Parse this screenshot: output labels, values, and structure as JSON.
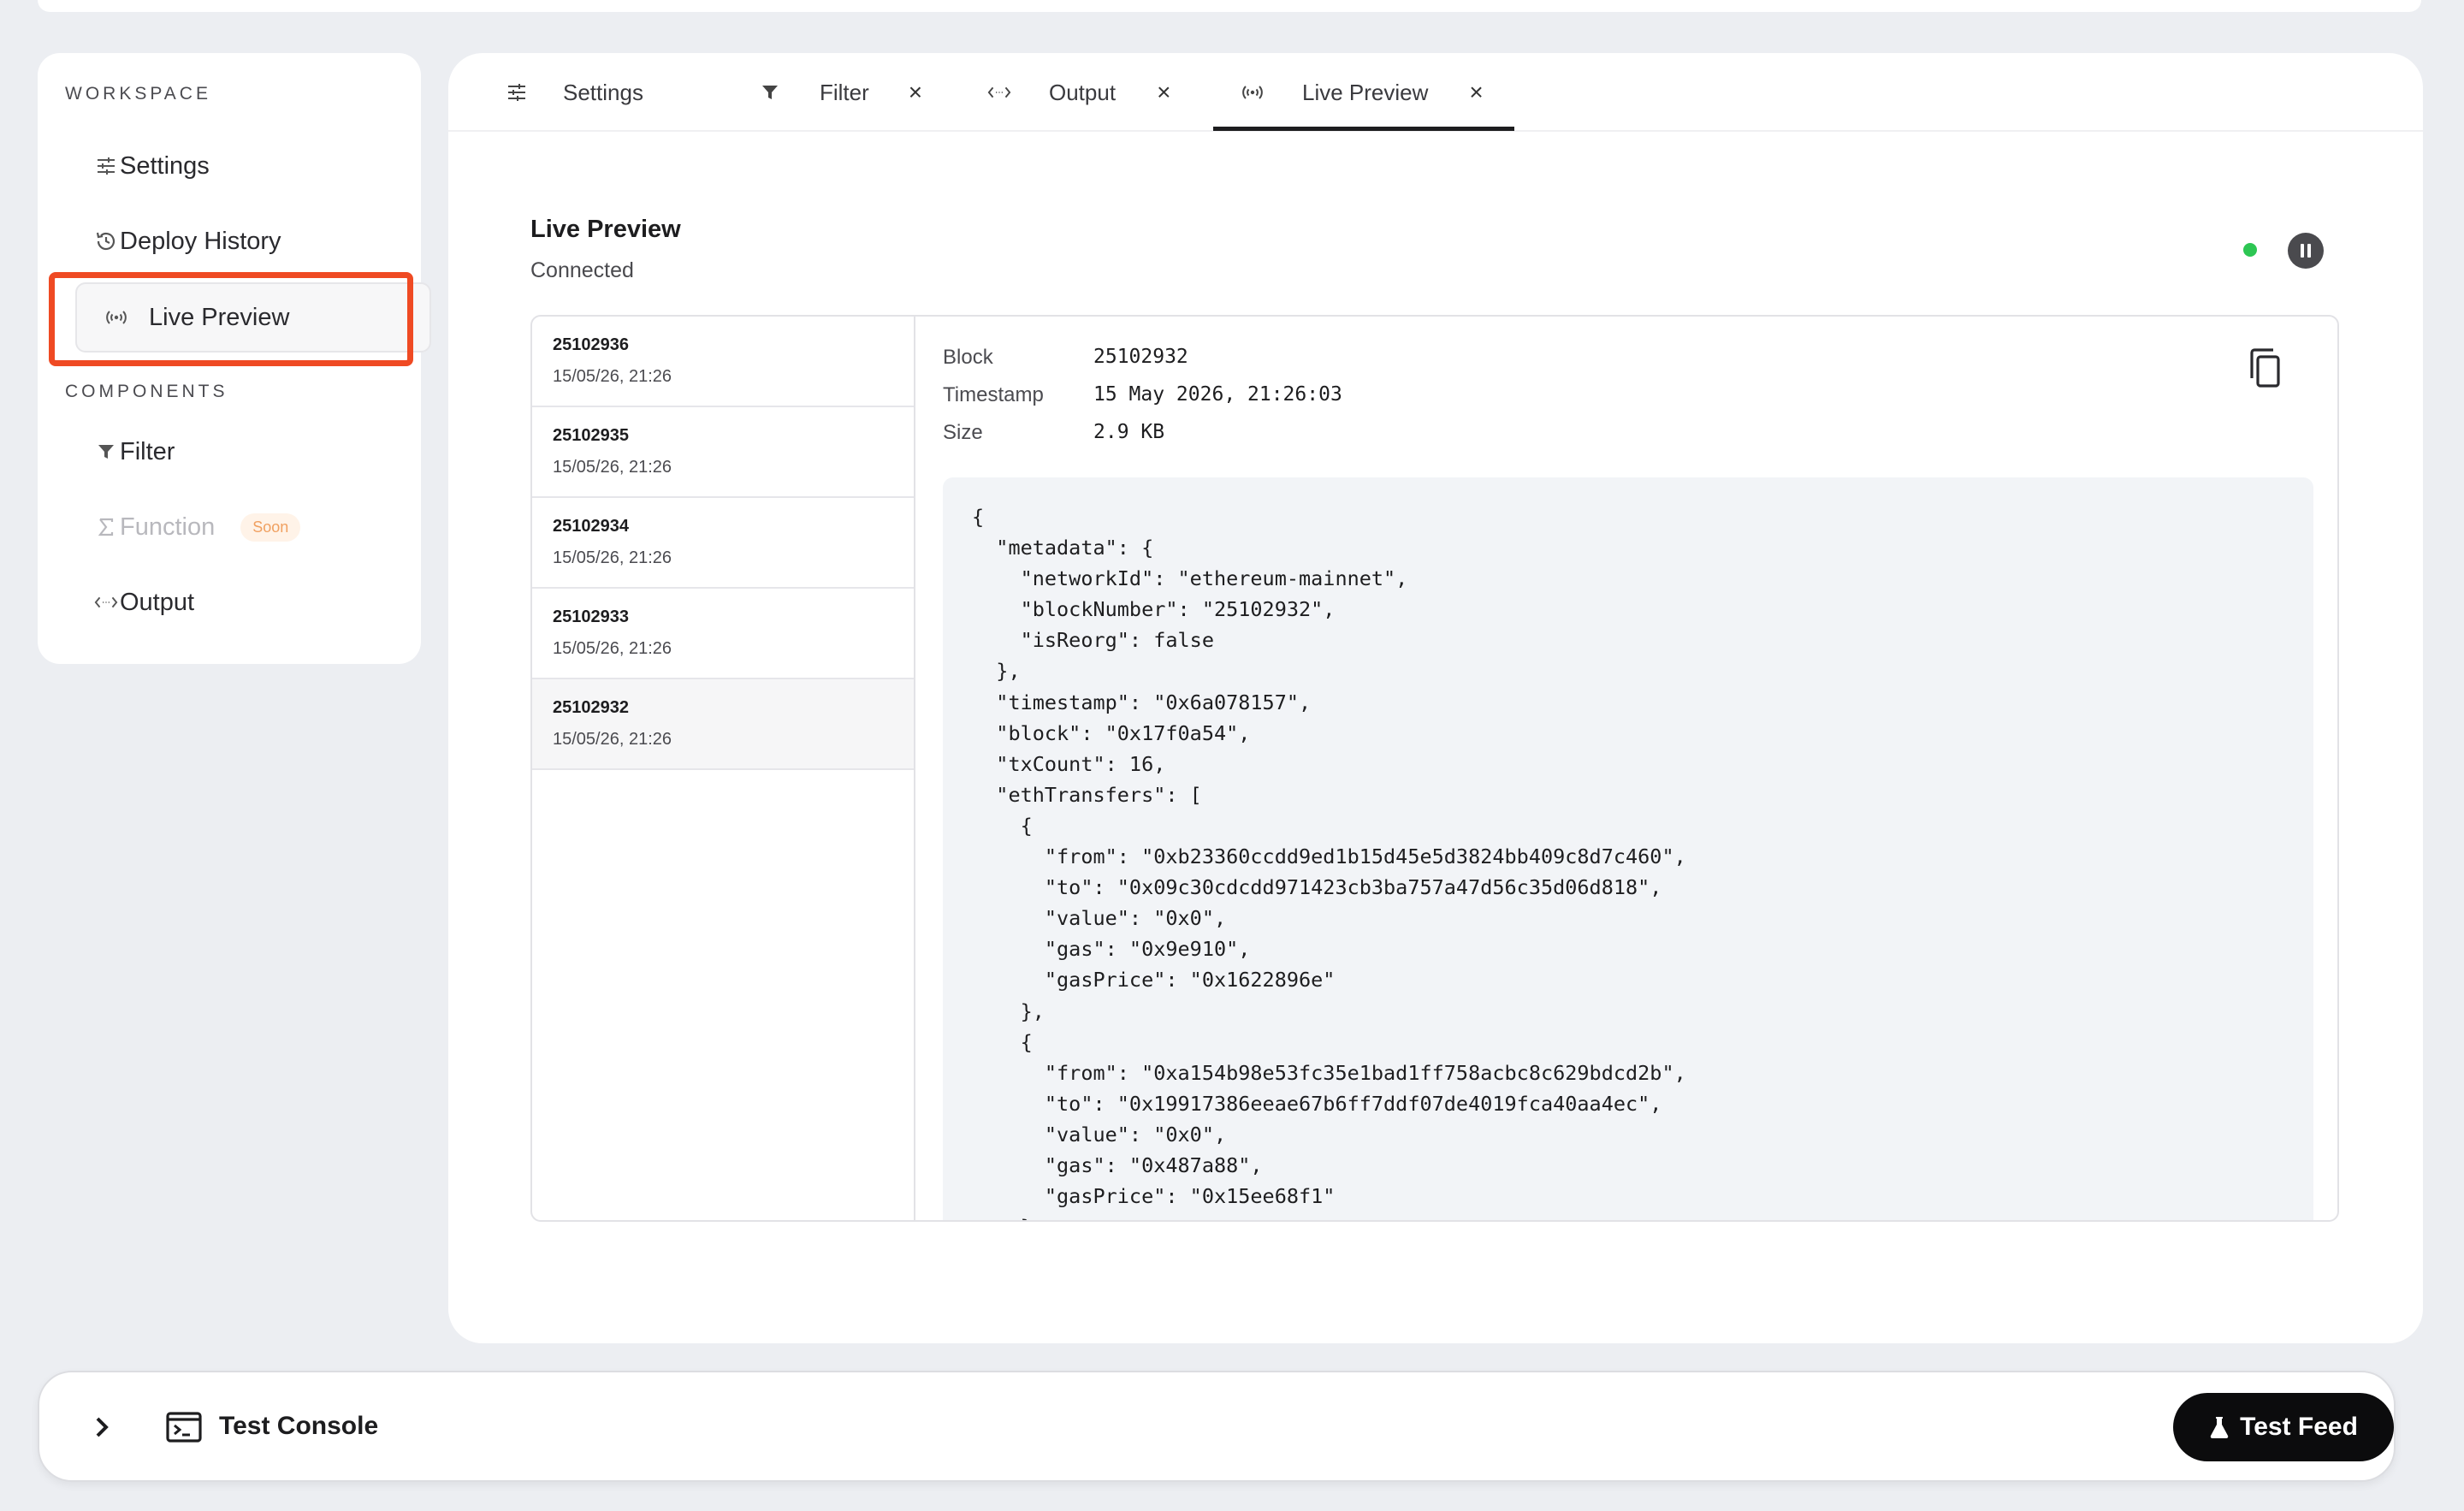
{
  "sidebar": {
    "workspace_title": "WORKSPACE",
    "components_title": "COMPONENTS",
    "items": [
      {
        "label": "Settings",
        "icon": "sliders-icon"
      },
      {
        "label": "Deploy History",
        "icon": "history-icon"
      },
      {
        "label": "Live Preview",
        "icon": "broadcast-icon",
        "active": true
      },
      {
        "label": "Filter",
        "icon": "funnel-icon"
      },
      {
        "label": "Function",
        "icon": "sigma-icon",
        "disabled": true,
        "badge": "Soon"
      },
      {
        "label": "Output",
        "icon": "code-arrows-icon"
      }
    ]
  },
  "tabs": [
    {
      "label": "Settings",
      "icon": "sliders-icon",
      "closable": false
    },
    {
      "label": "Filter",
      "icon": "funnel-icon",
      "closable": true
    },
    {
      "label": "Output",
      "icon": "code-arrows-icon",
      "closable": true
    },
    {
      "label": "Live Preview",
      "icon": "broadcast-icon",
      "closable": true,
      "active": true
    }
  ],
  "close_glyph": "×",
  "preview": {
    "title": "Live Preview",
    "status": "Connected",
    "status_color": "#2dc653"
  },
  "blocks": [
    {
      "number": "25102936",
      "time": "15/05/26, 21:26"
    },
    {
      "number": "25102935",
      "time": "15/05/26, 21:26"
    },
    {
      "number": "25102934",
      "time": "15/05/26, 21:26"
    },
    {
      "number": "25102933",
      "time": "15/05/26, 21:26"
    },
    {
      "number": "25102932",
      "time": "15/05/26, 21:26",
      "selected": true
    }
  ],
  "detail": {
    "block_label": "Block",
    "block_value": "25102932",
    "timestamp_label": "Timestamp",
    "timestamp_value": "15 May 2026, 21:26:03",
    "size_label": "Size",
    "size_value": "2.9 KB"
  },
  "json_lines": [
    "{",
    "  \"metadata\": {",
    "    \"networkId\": \"ethereum-mainnet\",",
    "    \"blockNumber\": \"25102932\",",
    "    \"isReorg\": false",
    "  },",
    "  \"timestamp\": \"0x6a078157\",",
    "  \"block\": \"0x17f0a54\",",
    "  \"txCount\": 16,",
    "  \"ethTransfers\": [",
    "    {",
    "      \"from\": \"0xb23360ccdd9ed1b15d45e5d3824bb409c8d7c460\",",
    "      \"to\": \"0x09c30cdcdd971423cb3ba757a47d56c35d06d818\",",
    "      \"value\": \"0x0\",",
    "      \"gas\": \"0x9e910\",",
    "      \"gasPrice\": \"0x1622896e\"",
    "    },",
    "    {",
    "      \"from\": \"0xa154b98e53fc35e1bad1ff758acbc8c629bdcd2b\",",
    "      \"to\": \"0x19917386eeae67b6ff7ddf07de4019fca40aa4ec\",",
    "      \"value\": \"0x0\",",
    "      \"gas\": \"0x487a88\",",
    "      \"gasPrice\": \"0x15ee68f1\"",
    "    },"
  ],
  "console": {
    "title": "Test Console",
    "test_feed_label": "Test Feed"
  }
}
